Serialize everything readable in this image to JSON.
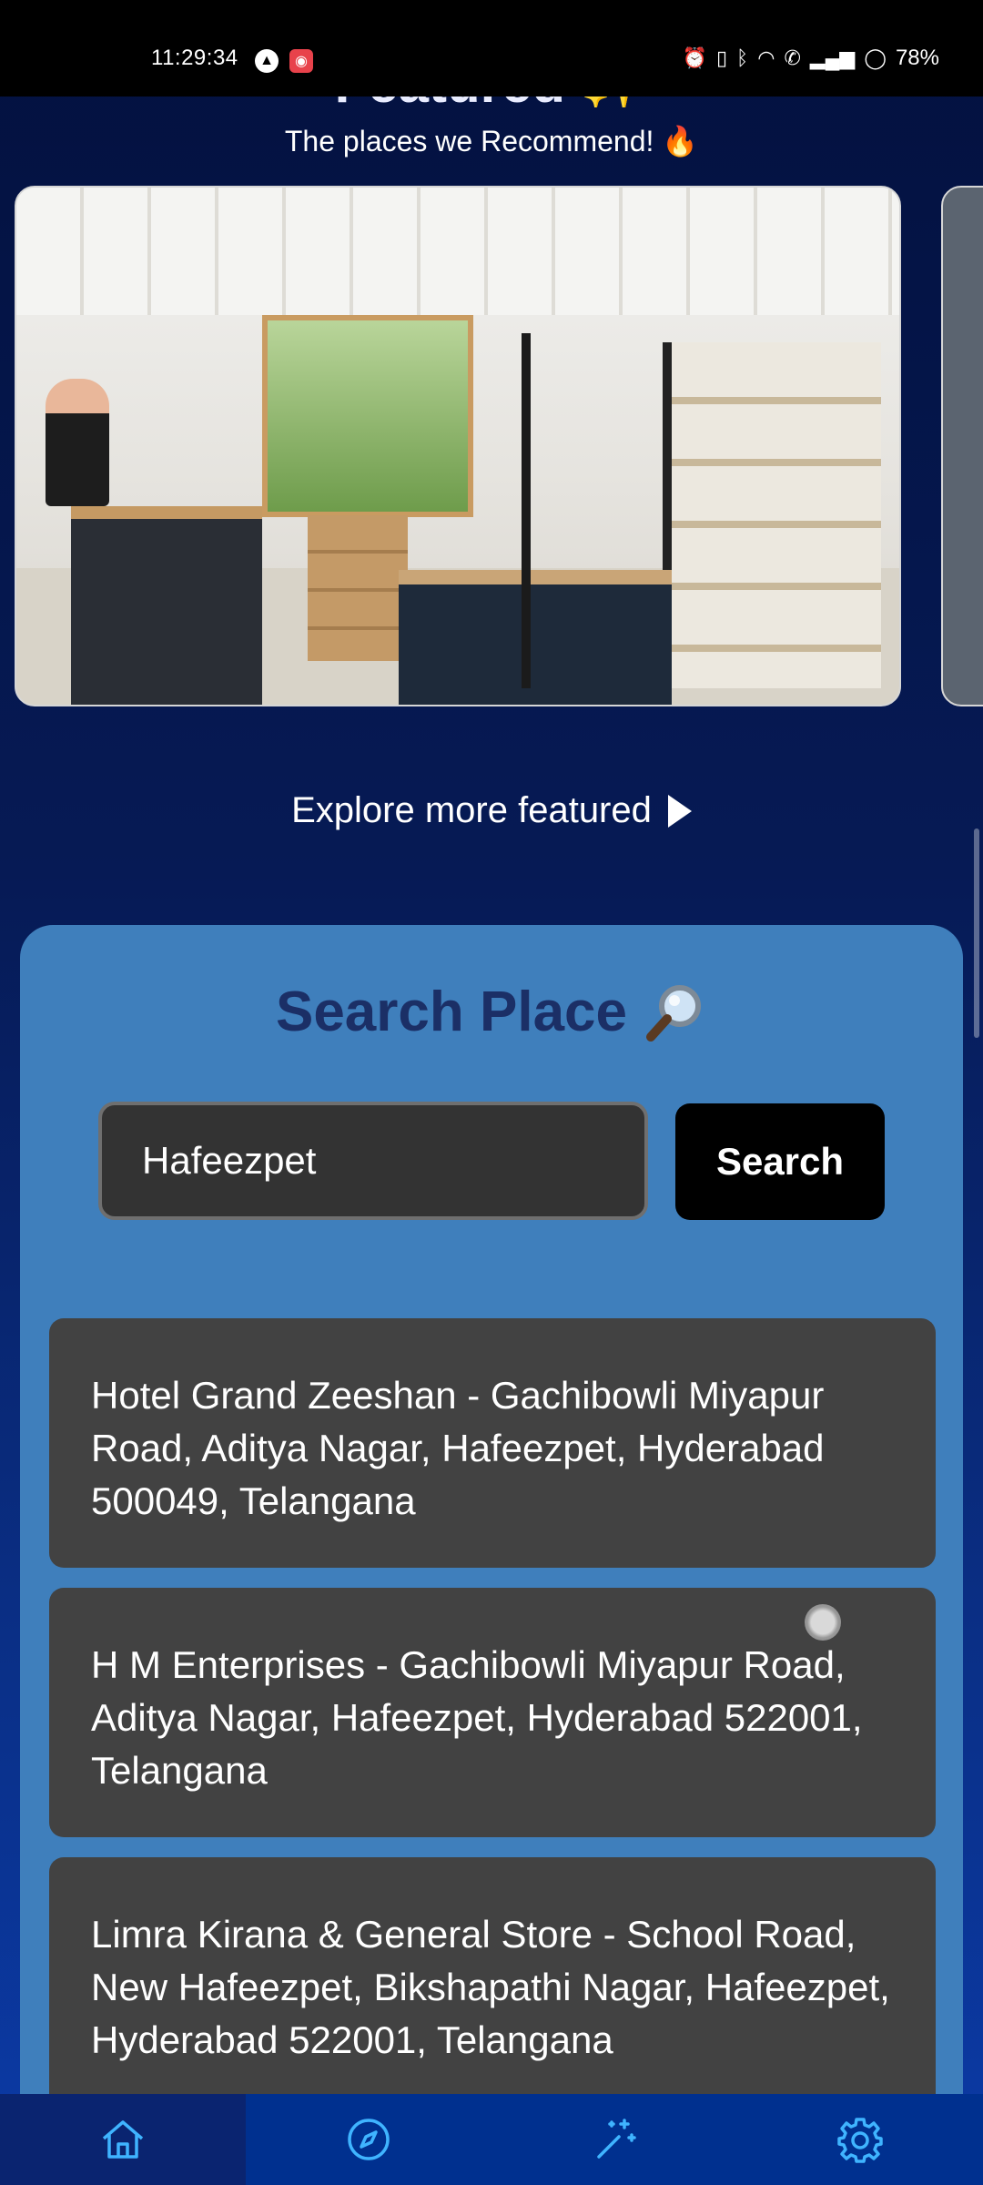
{
  "status_bar": {
    "time": "11:29:34",
    "battery": "78%"
  },
  "featured": {
    "title": "Featured ✨",
    "subtitle": "The places we Recommend! 🔥",
    "explore_link": "Explore more featured"
  },
  "search": {
    "title": "Search Place",
    "input_value": "Hafeezpet",
    "button_label": "Search"
  },
  "results": [
    "Hotel Grand Zeeshan - Gachibowli Miyapur Road, Aditya Nagar, Hafeezpet, Hyderabad 500049, Telangana",
    "H M Enterprises - Gachibowli Miyapur Road, Aditya Nagar, Hafeezpet, Hyderabad 522001, Telangana",
    "Limra Kirana & General Store - School Road, New Hafeezpet, Bikshapathi Nagar, Hafeezpet, Hyderabad 522001, Telangana"
  ],
  "colors": {
    "background_top": "#03113f",
    "panel": "#3f7fbc",
    "title": "#1b2f66",
    "result_card": "#424242",
    "nav_bar": "#00308f"
  },
  "nav": {
    "icons": [
      "home-icon",
      "compass-icon",
      "magic-wand-icon",
      "gear-icon"
    ],
    "active_index": 0
  }
}
